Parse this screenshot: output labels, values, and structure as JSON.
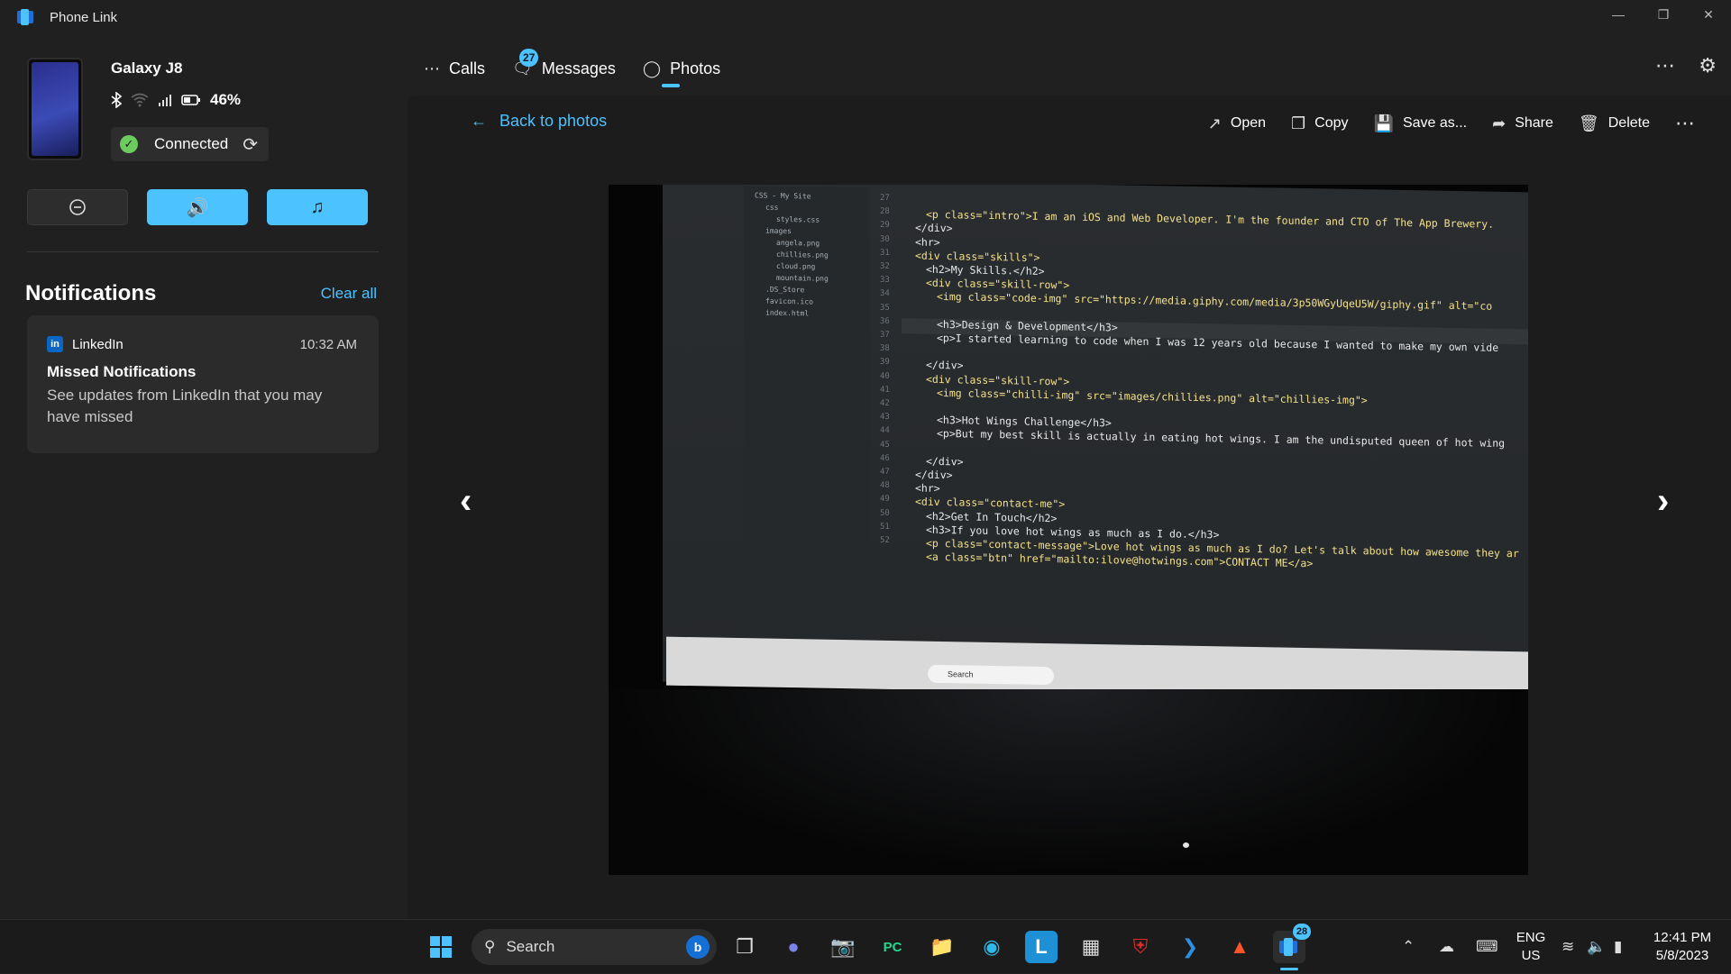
{
  "app": {
    "title": "Phone Link",
    "window_controls": [
      "minimize-icon",
      "restore-icon",
      "close-icon"
    ]
  },
  "device": {
    "name": "Galaxy J8",
    "battery": "46%",
    "connection_status": "Connected",
    "status_icons": [
      "bluetooth-icon",
      "wifi-icon",
      "signal-icon",
      "battery-icon"
    ]
  },
  "quick_actions": [
    {
      "icon": "do-not-disturb-icon",
      "active": false
    },
    {
      "icon": "volume-icon",
      "active": true
    },
    {
      "icon": "music-note-icon",
      "active": true
    }
  ],
  "notifications": {
    "title": "Notifications",
    "clear_all": "Clear all",
    "items": [
      {
        "app": "LinkedIn",
        "time": "10:32 AM",
        "title": "Missed Notifications",
        "body": "See updates from LinkedIn that you may have missed"
      }
    ]
  },
  "tabs": [
    {
      "label": "Calls",
      "icon": "dialpad-icon",
      "badge": ""
    },
    {
      "label": "Messages",
      "icon": "chat-icon",
      "badge": "27"
    },
    {
      "label": "Photos",
      "icon": "photos-icon",
      "badge": "",
      "selected": true
    }
  ],
  "viewer": {
    "back_label": "Back to photos",
    "toolbar": {
      "open": "Open",
      "copy": "Copy",
      "save_as": "Save as...",
      "share": "Share",
      "delete": "Delete"
    }
  },
  "photo_content": {
    "file_tree": [
      "CSS - My Site",
      "css",
      "styles.css",
      "images",
      "angela.png",
      "chillies.png",
      "cloud.png",
      "mountain.png",
      ".DS_Store",
      "favicon.ico",
      "index.html"
    ],
    "line_numbers": [
      "27",
      "28",
      "29",
      "30",
      "31",
      "32",
      "33",
      "34",
      "35",
      "36",
      "37",
      "38",
      "39",
      "40",
      "41",
      "42",
      "43",
      "44",
      "45",
      "46",
      "47",
      "48",
      "49",
      "50",
      "51",
      "52"
    ],
    "code_lines": [
      "<p class=\"intro\">I am an iOS and Web Developer. I'm the founder and CTO of The App Brewery.",
      "</div>",
      "<hr>",
      "<div class=\"skills\">",
      "<h2>My Skills.</h2>",
      "<div class=\"skill-row\">",
      "<img class=\"code-img\" src=\"https://media.giphy.com/media/3p50WGyUqeU5W/giphy.gif\" alt=\"co",
      "<h3>Design & Development</h3>",
      "<p>I started learning to code when I was 12 years old because I wanted to make my own vide",
      "</div>",
      "<div class=\"skill-row\">",
      "<img class=\"chilli-img\" src=\"images/chillies.png\" alt=\"chillies-img\">",
      "<h3>Hot Wings Challenge</h3>",
      "<p>But my best skill is actually in eating hot wings. I am the undisputed queen of hot wing",
      "</div>",
      "</div>",
      "<hr>",
      "<div class=\"contact-me\">",
      "<h2>Get In Touch</h2>",
      "<h3>If you love hot wings as much as I do.</h3>",
      "<p class=\"contact-message\">Love hot wings as much as I do? Let's talk about how awesome they ar",
      "<a class=\"btn\" href=\"mailto:ilove@hotwings.com\">CONTACT ME</a>"
    ],
    "screen_search": "Search"
  },
  "taskbar": {
    "search_placeholder": "Search",
    "phone_link_badge": "28",
    "language": {
      "line1": "ENG",
      "line2": "US"
    },
    "clock": {
      "time": "12:41 PM",
      "date": "5/8/2023"
    }
  },
  "colors": {
    "accent": "#4cc2ff",
    "background": "#202020",
    "card": "#2b2b2b",
    "success": "#6ccb5f"
  }
}
